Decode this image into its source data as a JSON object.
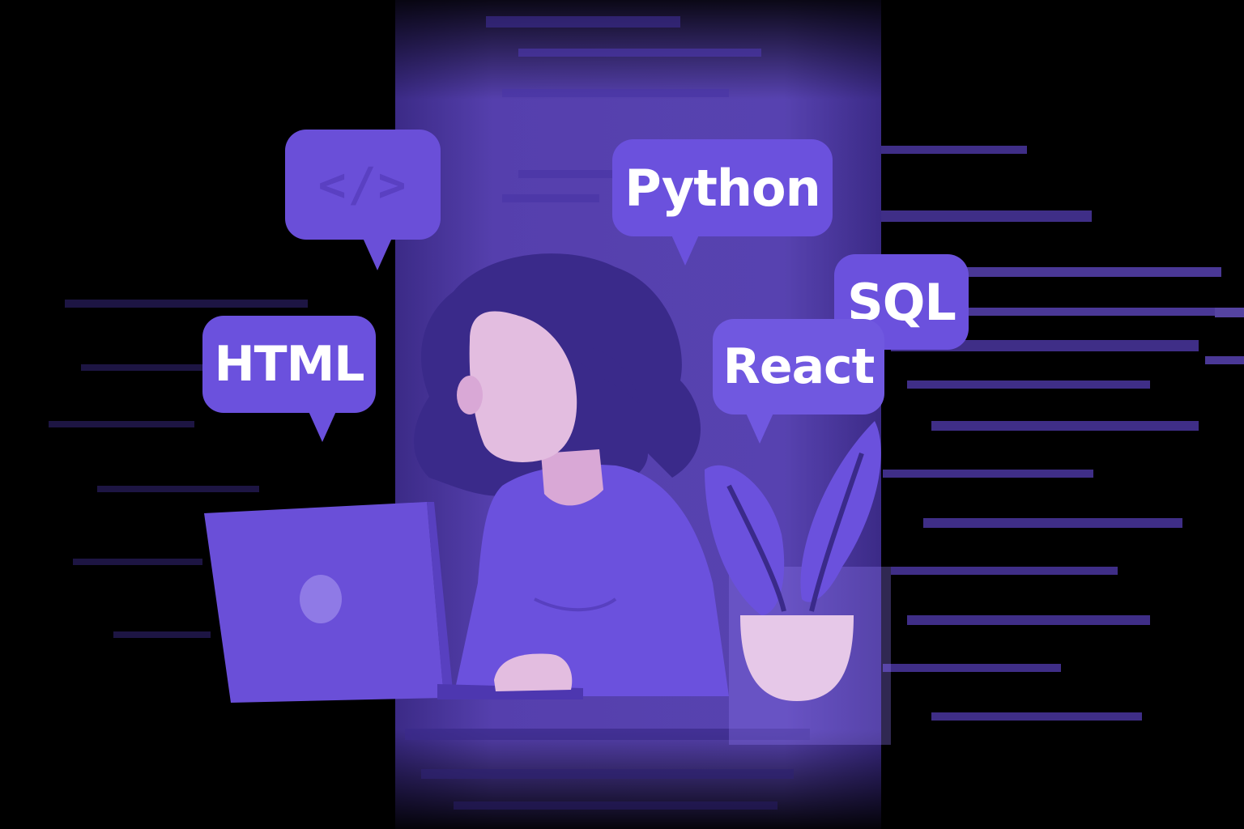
{
  "bubbles": {
    "code_icon": "code-icon",
    "code_glyph": "</>",
    "python": "Python",
    "html": "HTML",
    "sql": "SQL",
    "react": "React"
  },
  "colors": {
    "background": "#000000",
    "panel_purple": "#6a4fd8",
    "hair": "#3a2a8a",
    "skin": "#e3bde0",
    "shirt": "#6b51dd",
    "laptop": "#6a4fd8",
    "pot": "#e6c8e8"
  },
  "illustration": {
    "person": "woman-figure",
    "device": "laptop",
    "plant": "potted-plant"
  }
}
